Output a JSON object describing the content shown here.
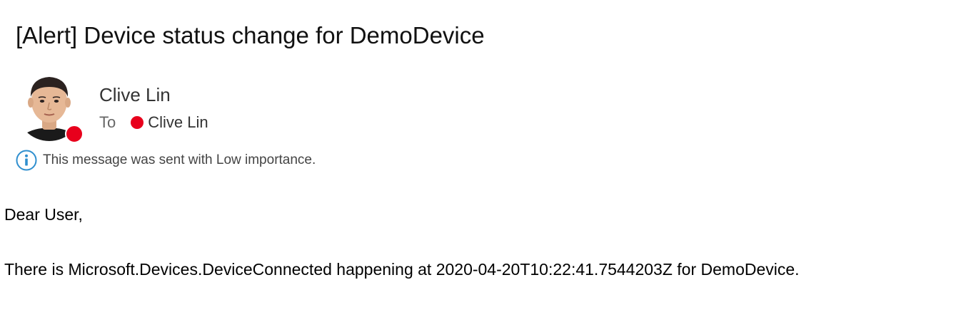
{
  "email": {
    "subject": "[Alert] Device status change for DemoDevice",
    "sender": {
      "name": "Clive Lin",
      "presence_color": "#e8001c"
    },
    "recipients": {
      "to_label": "To",
      "list": [
        {
          "name": "Clive Lin",
          "presence_color": "#e8001c"
        }
      ]
    },
    "importance_notice": "This message was sent with Low importance.",
    "body": {
      "greeting": "Dear User,",
      "message": "There is Microsoft.Devices.DeviceConnected happening at 2020-04-20T10:22:41.7544203Z for DemoDevice."
    }
  },
  "icons": {
    "importance": "info-icon",
    "sender_avatar": "avatar"
  },
  "colors": {
    "presence_busy": "#e8001c",
    "info_blue": "#2f8fcf"
  }
}
